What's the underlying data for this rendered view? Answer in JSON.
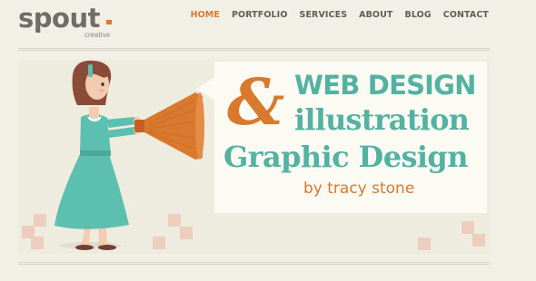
{
  "brand": {
    "name": "spout",
    "tagline": "creative"
  },
  "nav": {
    "items": [
      {
        "label": "HOME",
        "active": true
      },
      {
        "label": "PORTFOLIO",
        "active": false
      },
      {
        "label": "SERVICES",
        "active": false
      },
      {
        "label": "ABOUT",
        "active": false
      },
      {
        "label": "BLOG",
        "active": false
      },
      {
        "label": "CONTACT",
        "active": false
      }
    ]
  },
  "hero": {
    "ampersand": "&",
    "line1": "WEB DESIGN",
    "line2": "illustration",
    "line3": "Graphic Design",
    "byline": "by tracy stone",
    "illustration": "girl-with-megaphone"
  },
  "colors": {
    "accent_orange": "#d9792e",
    "accent_teal": "#54b2a2",
    "background": "#f1efe6",
    "nav_text": "#5f5e59"
  }
}
